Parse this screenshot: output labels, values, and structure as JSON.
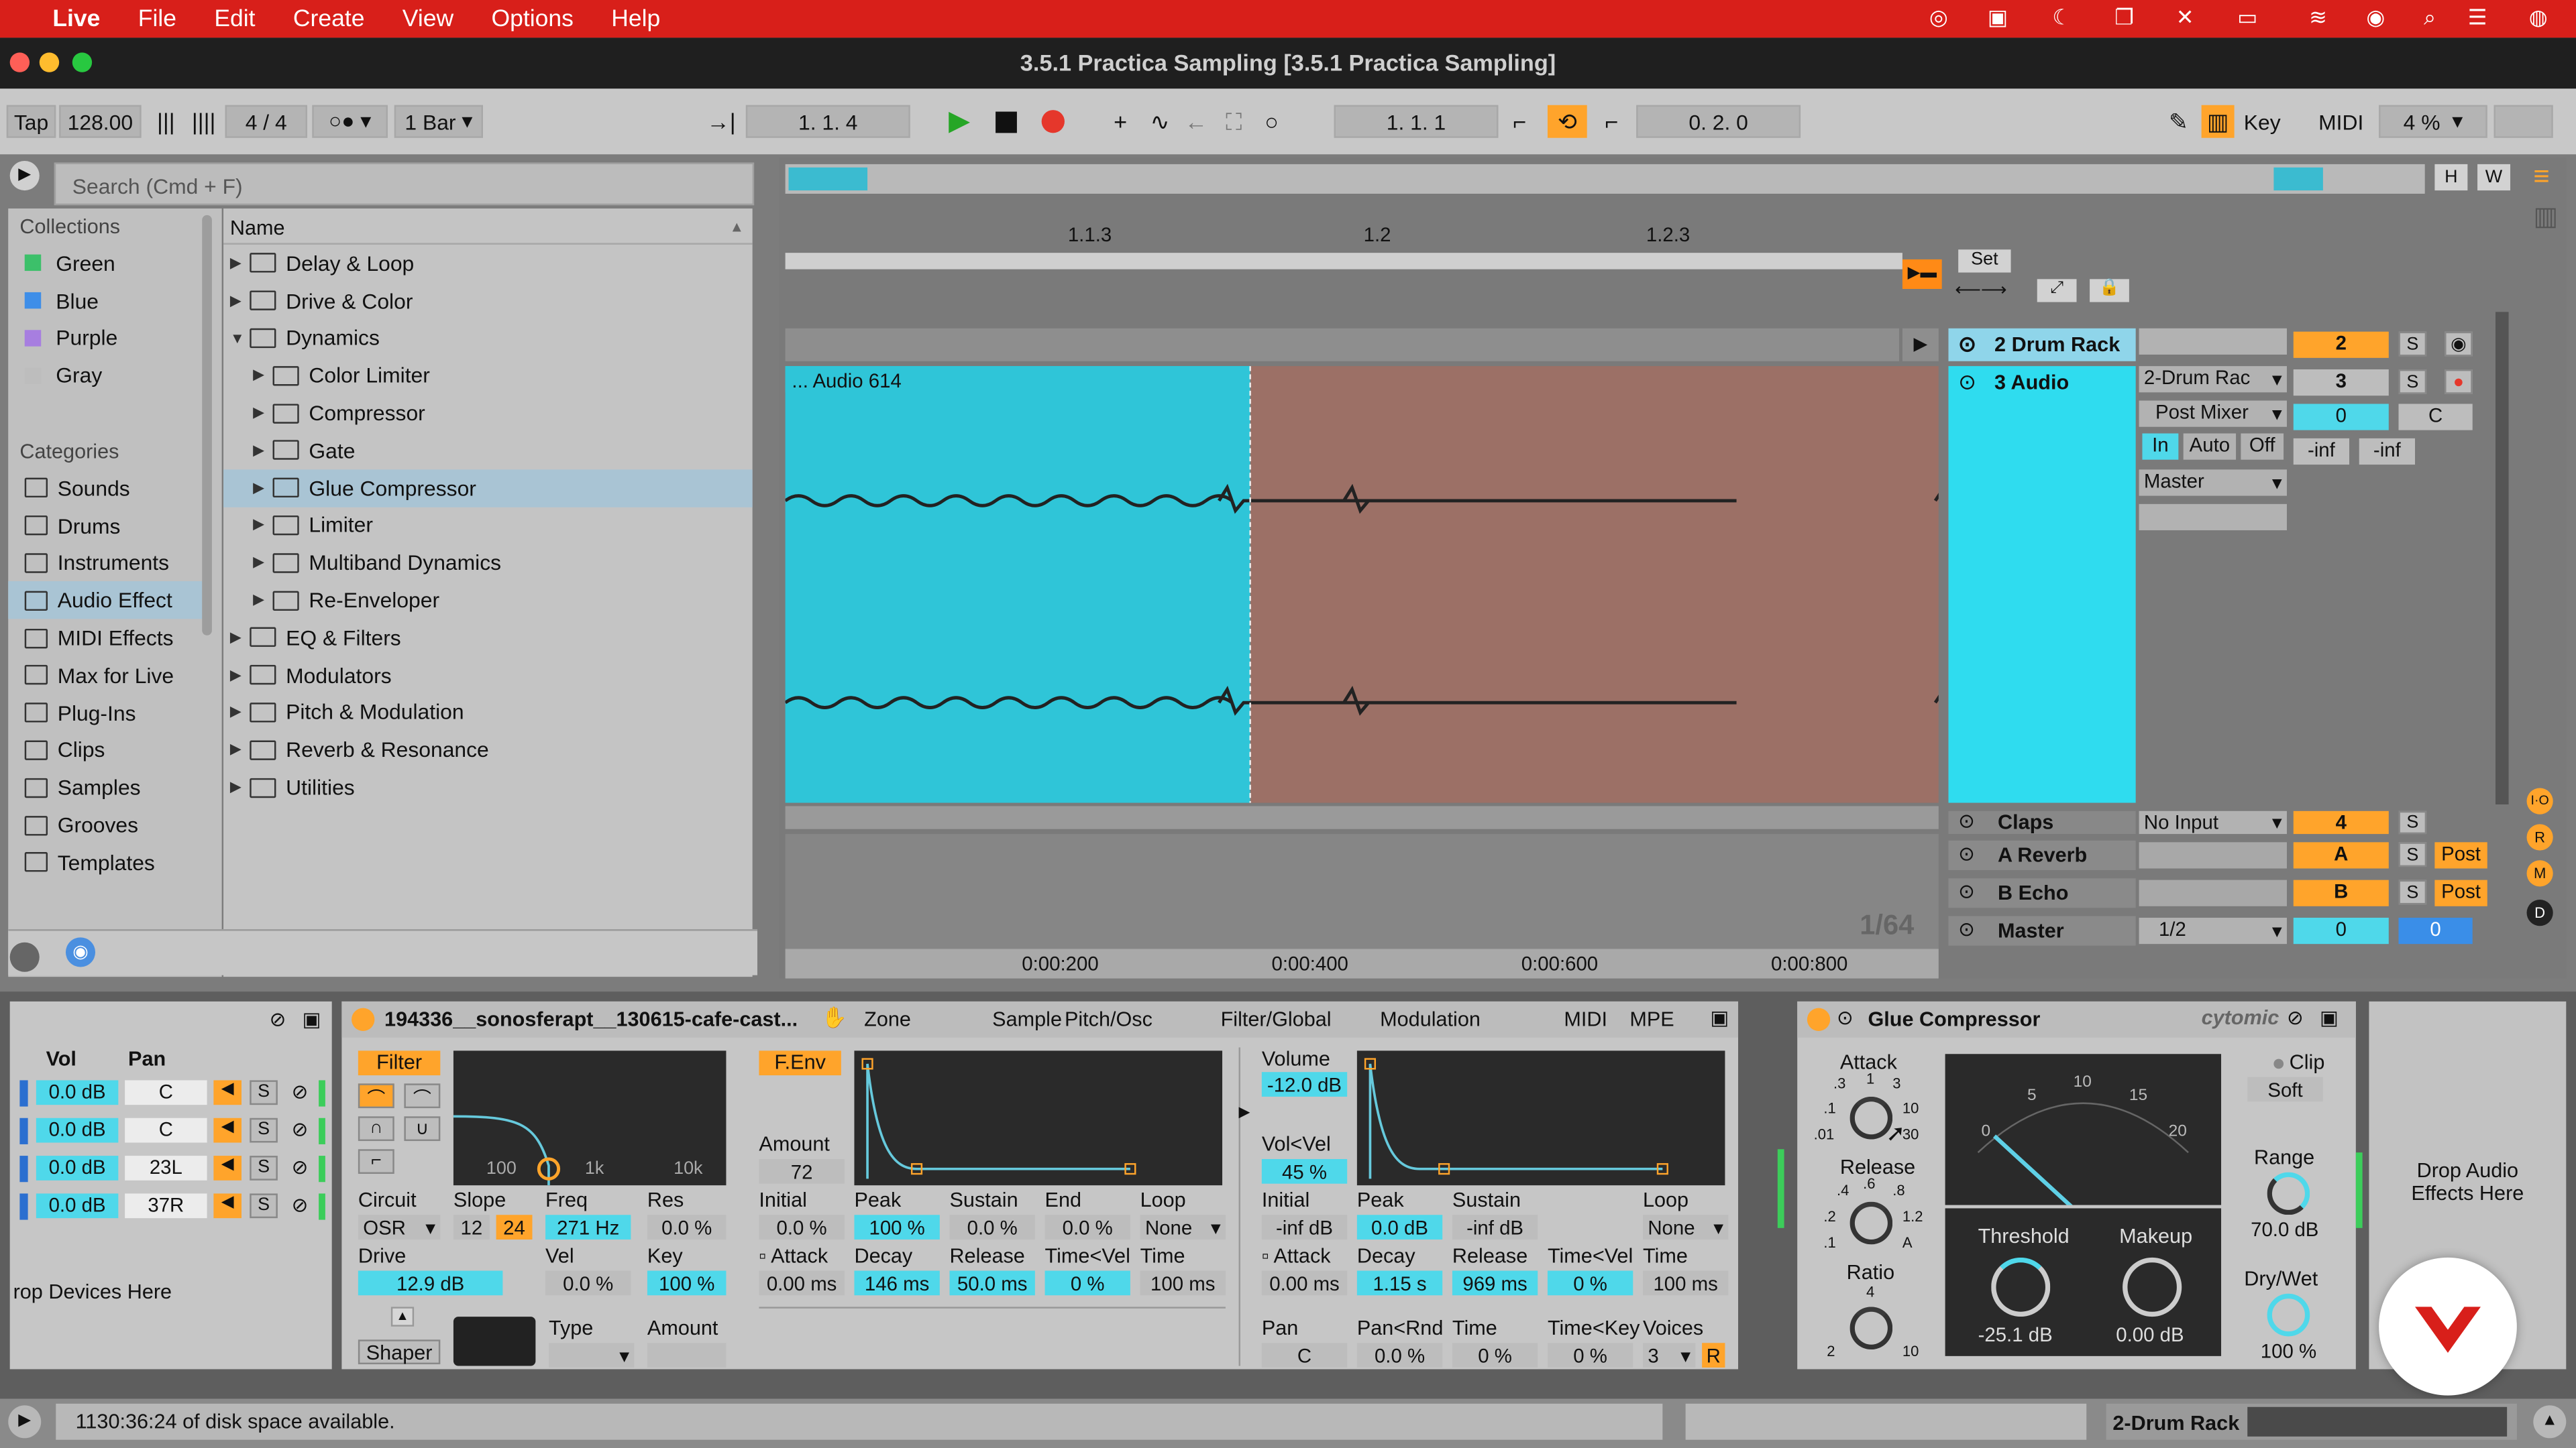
{
  "menubar": {
    "app": "Live",
    "items": [
      "File",
      "Edit",
      "Create",
      "View",
      "Options",
      "Help"
    ]
  },
  "title": "3.5.1 Practica Sampling  [3.5.1 Practica Sampling]",
  "transport": {
    "tap": "Tap",
    "tempo": "128.00",
    "signature": "4 / 4",
    "quantize": "1 Bar",
    "arrangement_position": "1.   1.   4",
    "loop_start": "1.   1.   1",
    "loop_length": "0.   2.   0",
    "key": "Key",
    "midi": "MIDI",
    "zoom": "4 %",
    "cpu_label": ""
  },
  "browser": {
    "search_placeholder": "Search (Cmd + F)",
    "collections_title": "Collections",
    "collections": [
      {
        "label": "Green",
        "color": "#3cc06a"
      },
      {
        "label": "Blue",
        "color": "#3e8ee8"
      },
      {
        "label": "Purple",
        "color": "#a77ee0"
      },
      {
        "label": "Gray",
        "color": "#bdbdbd"
      }
    ],
    "categories_title": "Categories",
    "categories": [
      "Sounds",
      "Drums",
      "Instruments",
      "Audio Effect",
      "MIDI Effects",
      "Max for Live",
      "Plug-Ins",
      "Clips",
      "Samples",
      "Grooves",
      "Templates"
    ],
    "name_header": "Name",
    "tree": [
      {
        "label": "Delay & Loop",
        "level": 0,
        "open": false,
        "selected": false
      },
      {
        "label": "Drive & Color",
        "level": 0,
        "open": false,
        "selected": false
      },
      {
        "label": "Dynamics",
        "level": 0,
        "open": true,
        "selected": false
      },
      {
        "label": "Color Limiter",
        "level": 1,
        "open": false,
        "selected": false
      },
      {
        "label": "Compressor",
        "level": 1,
        "open": false,
        "selected": false
      },
      {
        "label": "Gate",
        "level": 1,
        "open": false,
        "selected": false
      },
      {
        "label": "Glue Compressor",
        "level": 1,
        "open": false,
        "selected": true
      },
      {
        "label": "Limiter",
        "level": 1,
        "open": false,
        "selected": false
      },
      {
        "label": "Multiband Dynamics",
        "level": 1,
        "open": false,
        "selected": false
      },
      {
        "label": "Re-Enveloper",
        "level": 1,
        "open": false,
        "selected": false
      },
      {
        "label": "EQ & Filters",
        "level": 0,
        "open": false,
        "selected": false
      },
      {
        "label": "Modulators",
        "level": 0,
        "open": false,
        "selected": false
      },
      {
        "label": "Pitch & Modulation",
        "level": 0,
        "open": false,
        "selected": false
      },
      {
        "label": "Reverb & Resonance",
        "level": 0,
        "open": false,
        "selected": false
      },
      {
        "label": "Utilities",
        "level": 0,
        "open": false,
        "selected": false
      }
    ]
  },
  "arrangement": {
    "ruler": [
      "1.1.3",
      "1.2",
      "1.2.3"
    ],
    "time_ruler": [
      "0:00:200",
      "0:00:400",
      "0:00:600",
      "0:00:800"
    ],
    "clip_name": "... Audio 614",
    "grid": "1/64",
    "set_label": "Set",
    "tracks": [
      {
        "name": "2 Drum Rack",
        "num": "2",
        "color": "#4fd8ea"
      },
      {
        "name": "3 Audio",
        "num": "3",
        "color": "#4fd8ea",
        "input": "2-Drum Rac",
        "route": "Post Mixer",
        "monitor": [
          "In",
          "Auto",
          "Off"
        ],
        "output": "Master",
        "vol": "0",
        "pan": "C",
        "inf1": "-inf",
        "inf2": "-inf"
      },
      {
        "name": "Claps",
        "num": "4",
        "color": "#ffffff",
        "input": "No Input"
      },
      {
        "name": "A Reverb",
        "num": "A",
        "post": "Post"
      },
      {
        "name": "B Echo",
        "num": "B",
        "post": "Post"
      },
      {
        "name": "Master",
        "num": "0",
        "ratio": "1/2",
        "vol2": "0"
      }
    ]
  },
  "drum_rack": {
    "vol_header": "Vol",
    "pan_header": "Pan",
    "rows": [
      {
        "vol": "0.0 dB",
        "pan": "C"
      },
      {
        "vol": "0.0 dB",
        "pan": "C"
      },
      {
        "vol": "0.0 dB",
        "pan": "23L"
      },
      {
        "vol": "0.0 dB",
        "pan": "37R"
      }
    ],
    "drop_text": "rop Devices Here"
  },
  "simpler": {
    "sample_name": "194336__sonosferapt__130615-cafe-cast...",
    "tabs": [
      "Zone",
      "Sample",
      "Pitch/Osc",
      "Filter/Global",
      "Modulation",
      "MIDI",
      "MPE"
    ],
    "filter_label": "Filter",
    "fenv_label": "F.Env",
    "freq_ticks": [
      "100",
      "1k",
      "10k"
    ],
    "circuit_label": "Circuit",
    "circuit_value": "OSR",
    "slope_label": "Slope",
    "slope_values": [
      "12",
      "24"
    ],
    "freq_label": "Freq",
    "freq_value": "271 Hz",
    "res_label": "Res",
    "res_value": "0.0 %",
    "drive_label": "Drive",
    "drive_value": "12.9 dB",
    "vel_label": "Vel",
    "vel_value": "0.0 %",
    "key_label": "Key",
    "key_value": "100 %",
    "amount_label": "Amount",
    "amount_value": "72",
    "env1": {
      "initial_label": "Initial",
      "initial": "0.0 %",
      "peak_label": "Peak",
      "peak": "100 %",
      "sustain_label": "Sustain",
      "sustain": "0.0 %",
      "end_label": "End",
      "end": "0.0 %",
      "loop_label": "Loop",
      "loop": "None",
      "attack_label": "Attack",
      "attack": "0.00 ms",
      "decay_label": "Decay",
      "decay": "146 ms",
      "release_label": "Release",
      "release": "50.0 ms",
      "timevel_label": "Time<Vel",
      "timevel": "0 %",
      "time_label": "Time",
      "time": "100 ms"
    },
    "shaper_label": "Shaper",
    "type_label": "Type",
    "amount2_label": "Amount",
    "volume_label": "Volume",
    "volume": "-12.0 dB",
    "volvel_label": "Vol<Vel",
    "volvel": "45 %",
    "env2": {
      "initial_label": "Initial",
      "initial": "-inf dB",
      "peak_label": "Peak",
      "peak": "0.0 dB",
      "sustain_label": "Sustain",
      "sustain": "-inf dB",
      "loop_label": "Loop",
      "loop": "None",
      "attack_label": "Attack",
      "attack": "0.00 ms",
      "decay_label": "Decay",
      "decay": "1.15 s",
      "release_label": "Release",
      "release": "969 ms",
      "timevel_label": "Time<Vel",
      "timevel": "0 %",
      "time_label": "Time",
      "time": "100 ms"
    },
    "pan_label": "Pan",
    "pan": "C",
    "panrnd_label": "Pan<Rnd",
    "panrnd": "0.0 %",
    "time2_label": "Time",
    "time2": "0 %",
    "timekey_label": "Time<Key",
    "timekey": "0 %",
    "voices_label": "Voices",
    "voices": "3",
    "r_label": "R"
  },
  "glue": {
    "title": "Glue Compressor",
    "brand": "cytomic",
    "attack_label": "Attack",
    "attack_ticks": [
      ".3",
      "1",
      "3",
      ".1",
      "10",
      ".01",
      "30"
    ],
    "release_label": "Release",
    "release_ticks": [
      ".4",
      ".6",
      ".8",
      ".2",
      "1.2",
      ".1",
      "A"
    ],
    "ratio_label": "Ratio",
    "ratio_ticks": [
      "4",
      "2",
      "10"
    ],
    "meter_ticks": [
      "0",
      "5",
      "10",
      "15",
      "20"
    ],
    "threshold_label": "Threshold",
    "threshold": "-25.1 dB",
    "makeup_label": "Makeup",
    "makeup": "0.00 dB",
    "clip_label": "Clip",
    "soft_label": "Soft",
    "range_label": "Range",
    "range": "70.0 dB",
    "drywet_label": "Dry/Wet",
    "drywet": "100 %"
  },
  "drop_audio": "Drop Audio Effects Here",
  "status": {
    "text": "1130:36:24 of disk space available.",
    "track": "2-Drum Rack"
  },
  "colors": {
    "accent": "#ffa42b",
    "clip": "#4fd8ea",
    "menubar": "#d81f1a"
  }
}
